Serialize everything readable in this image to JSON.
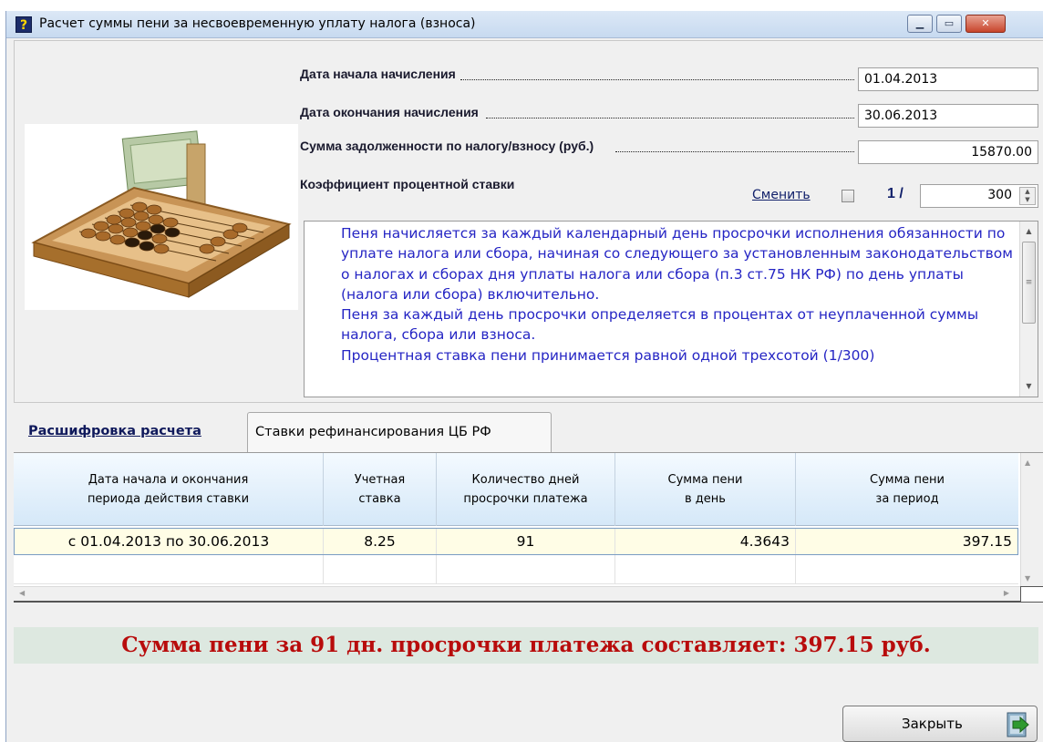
{
  "window": {
    "title": "Расчет суммы пени за несвоевременную уплату налога (взноса)",
    "title_icon": "question-mark-icon",
    "min_icon": "minimize-icon",
    "max_icon": "maximize-icon",
    "close_icon": "close-icon"
  },
  "form": {
    "start_date_label": "Дата начала начисления",
    "start_date_value": "01.04.2013",
    "end_date_label": "Дата окончания начисления",
    "end_date_value": "30.06.2013",
    "debt_label": "Сумма задолженности по налогу/взносу (руб.)",
    "debt_value": "15870.00",
    "rate_coef_label": "Коэффициент процентной ставки",
    "change_link": "Сменить",
    "change_checked": false,
    "fraction_prefix": "1 /",
    "fraction_value": "300"
  },
  "memo": {
    "paragraphs": [
      "Пеня начисляется за каждый календарный день просрочки исполнения обязанности по уплате налога или сбора, начиная со следующего за установленным законодательством о налогах и сборах дня уплаты налога или сбора (п.3 ст.75 НК РФ) по день уплаты (налога или сбора) включительно.",
      "Пеня за каждый день просрочки определяется в процентах от неуплаченной суммы налога, сбора или взноса.",
      "Процентная ставка пени принимается равной одной трехсотой (1/300)"
    ],
    "text_color": "#2525c4"
  },
  "tabs": [
    {
      "label": "Расшифровка расчета",
      "active": true
    },
    {
      "label": "Ставки рефинансирования ЦБ РФ",
      "active": false
    }
  ],
  "table": {
    "columns": [
      "Дата начала и окончания\nпериода действия ставки",
      "Учетная\nставка",
      "Количество дней\nпросрочки платежа",
      "Сумма пени\nв день",
      "Сумма пени\nза период"
    ],
    "rows": [
      [
        "с 01.04.2013 по 30.06.2013",
        "8.25",
        "91",
        "4.3643",
        "397.15"
      ]
    ]
  },
  "result": {
    "text": "Сумма пени за 91 дн. просрочки платежа составляет:  397.15 руб.",
    "color": "#b80c0c"
  },
  "buttons": {
    "close_label": "Закрыть",
    "close_icon": "exit-door-icon"
  },
  "colors": {
    "accent_dark": "#12216b",
    "row_highlight": "#fffde6",
    "result_bg": "#dde8e0"
  }
}
